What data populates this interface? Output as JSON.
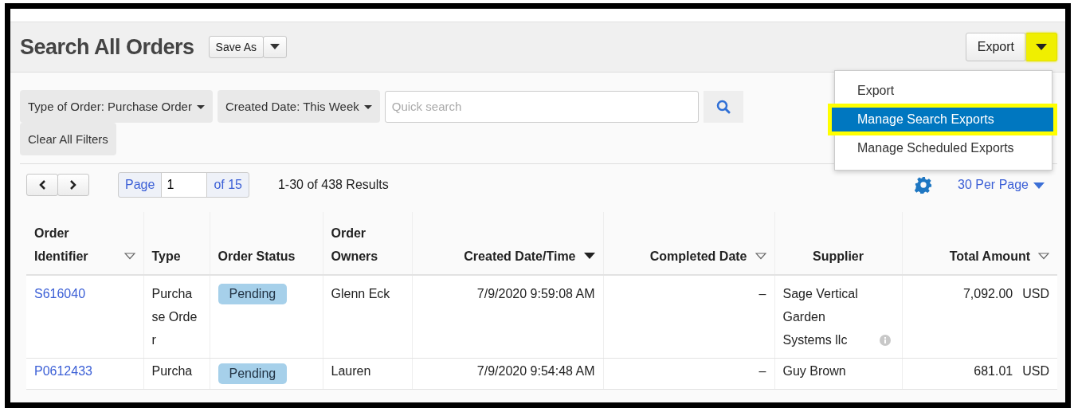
{
  "header": {
    "title": "Search All Orders",
    "save_button": "Save As",
    "export_button": "Export",
    "export_toggle_highlighted": true
  },
  "export_menu": {
    "expanded": true,
    "items": [
      {
        "label": "Export",
        "selected": false,
        "highlighted": false
      },
      {
        "label": "Manage Search Exports",
        "selected": true,
        "highlighted": true
      },
      {
        "label": "Manage Scheduled Exports",
        "selected": false,
        "highlighted": false
      }
    ]
  },
  "filters": [
    {
      "label": "Type of Order: Purchase Order"
    },
    {
      "label": "Created Date: This Week"
    }
  ],
  "search": {
    "placeholder": "Quick search"
  },
  "clear_filters": "Clear All Filters",
  "pagination": {
    "page_label": "Page",
    "page": "1",
    "of": "of 15",
    "results": "1-30 of 438 Results",
    "per_page": "30 Per Page"
  },
  "table": {
    "columns": [
      {
        "label": "Order Identifier",
        "sorted": false
      },
      {
        "label": "Type"
      },
      {
        "label": "Order Status"
      },
      {
        "label": "Order Owners"
      },
      {
        "label": "Created Date/Time",
        "sorted": true
      },
      {
        "label": "Completed Date",
        "sorted": false
      },
      {
        "label": "Supplier"
      },
      {
        "label": "Total Amount",
        "sorted": false
      }
    ],
    "rows": [
      {
        "id": "S616040",
        "type": "Purcha se Order",
        "status": "Pending",
        "owner": "Glenn Eck",
        "created": "7/9/2020 9:59:08 AM",
        "completed": "–",
        "supplier": "Sage Vertical Garden Systems llc",
        "supplier_info": true,
        "amount": "7,092.00",
        "currency": "USD"
      },
      {
        "id": "P0612433",
        "type": "Purcha",
        "status": "Pending",
        "owner": "Lauren",
        "created": "7/9/2020 9:54:48 AM",
        "completed": "–",
        "supplier": "Guy Brown",
        "amount": "681.01",
        "currency": "USD"
      }
    ]
  }
}
